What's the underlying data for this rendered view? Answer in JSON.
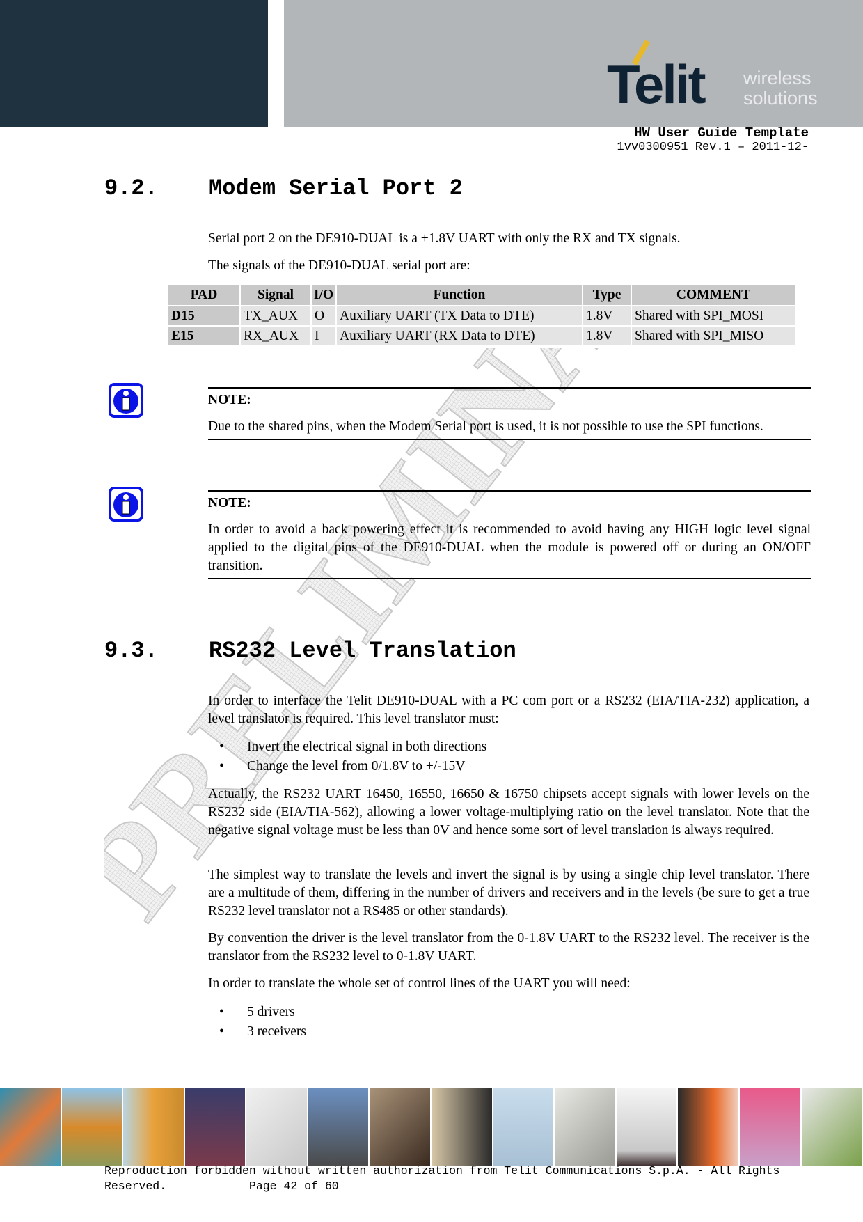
{
  "header": {
    "logo_main": "Telit",
    "logo_tagline_1": "wireless",
    "logo_tagline_2": "solutions",
    "doc_title": "HW User Guide Template",
    "doc_revision": "1vv0300951 Rev.1 – 2011-12-"
  },
  "section_92": {
    "number": "9.2.",
    "title": "Modem Serial Port 2",
    "intro_1": "Serial port 2 on the DE910-DUAL is a +1.8V UART with only the RX and TX signals.",
    "intro_2": "The signals of the DE910-DUAL serial port are:",
    "table": {
      "headers": [
        "PAD",
        "Signal",
        "I/O",
        "Function",
        "Type",
        "COMMENT"
      ],
      "rows": [
        [
          "D15",
          "TX_AUX",
          "O",
          "Auxiliary UART (TX Data to DTE)",
          "1.8V",
          "Shared with SPI_MOSI"
        ],
        [
          "E15",
          "RX_AUX",
          "I",
          "Auxiliary UART (RX Data to DTE)",
          "1.8V",
          "Shared with SPI_MISO"
        ]
      ]
    },
    "notes": [
      {
        "icon": "info-icon",
        "title": "NOTE:",
        "text": "Due to the shared pins, when the Modem Serial port is used, it is not possible to use the SPI functions."
      },
      {
        "icon": "info-icon",
        "title": "NOTE:",
        "text": "In order to avoid a back powering effect it is recommended to avoid having any HIGH logic level signal applied to the digital pins of the DE910-DUAL when the module is powered off or during an ON/OFF transition."
      }
    ]
  },
  "section_93": {
    "number": "9.3.",
    "title": "RS232 Level Translation",
    "para_1": "In order to interface the Telit DE910-DUAL with a PC com port or a RS232 (EIA/TIA-232) application, a level translator is required. This level translator must:",
    "bullets_1": [
      "Invert the electrical signal in both directions",
      "Change the level from 0/1.8V to +/-15V"
    ],
    "para_2": "Actually, the RS232 UART 16450, 16550, 16650 & 16750 chipsets accept signals with lower levels on the RS232 side (EIA/TIA-562), allowing a lower voltage-multiplying ratio on the level translator. Note that the negative signal voltage must be less than 0V and hence some sort of level translation is always required.",
    "para_3": "The simplest way to translate the levels and invert the signal is by using a single chip level translator. There are a multitude of them, differing in the number of drivers and receivers and in the levels (be sure to get a true RS232 level translator not a RS485 or other standards).",
    "para_4": "By convention the driver is the level translator from the 0-1.8V UART to the RS232 level. The receiver is the translator from the RS232 level to 0-1.8V UART.",
    "para_5": "In order to translate the whole set of control lines of the UART you will need:",
    "bullets_2": [
      "5 drivers",
      "3 receivers"
    ]
  },
  "watermark": "PRELIMINARY",
  "footer": {
    "line_1": "Reproduction forbidden without written authorization from Telit Communications S.p.A. - All Rights",
    "line_2": "Reserved.            Page 42 of 60"
  },
  "colors": {
    "header_dark": "#1f323f",
    "header_gray": "#b3b6b9",
    "logo_accent": "#e6b82a",
    "info_icon_blue": "#0a14e6",
    "table_header_bg": "#c9c9c9",
    "table_cell_bg": "#e4e4e4"
  }
}
